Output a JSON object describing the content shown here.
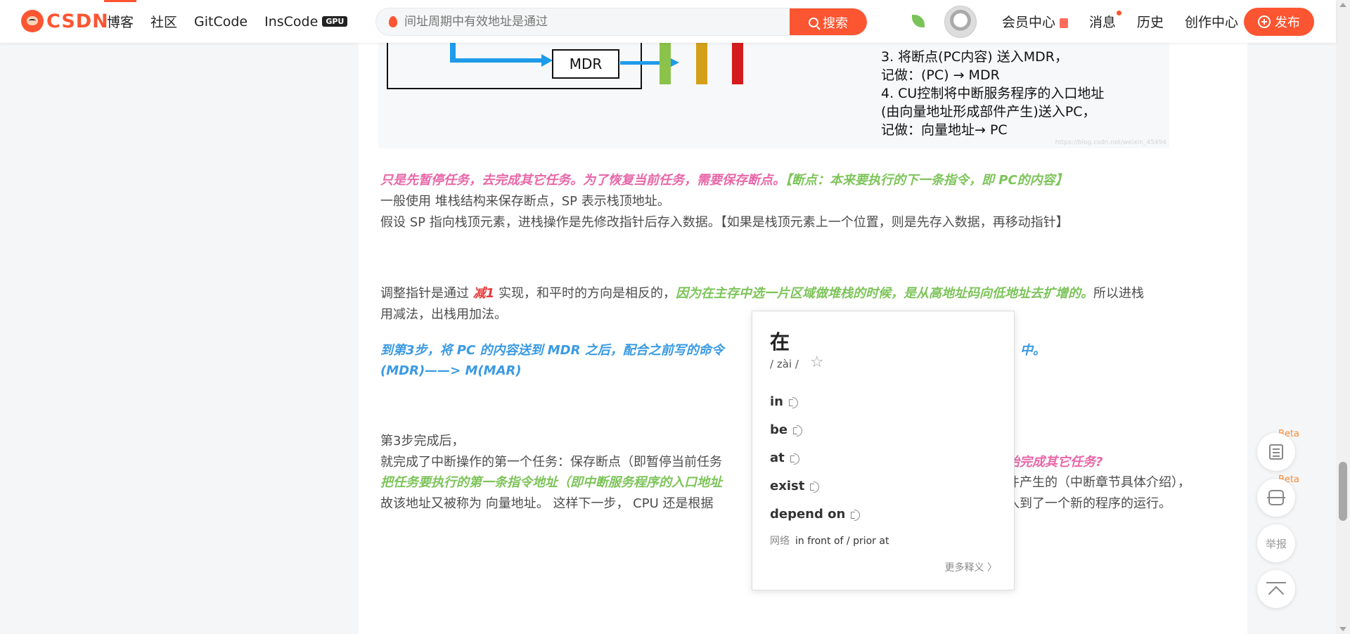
{
  "header": {
    "logo_text": "CSDN",
    "nav": [
      "博客",
      "社区",
      "GitCode",
      "InsCode"
    ],
    "gpu_badge": "GPU",
    "search_placeholder": "间址周期中有效地址是通过",
    "search_button": "搜索",
    "right_nav": {
      "member": "会员中心",
      "messages": "消息",
      "history": "历史",
      "create": "创作中心"
    },
    "publish": "发布",
    "accent_color": "#fc5531"
  },
  "figure": {
    "mdr_label": "MDR",
    "lines": [
      "3. 将断点(PC内容) 送入MDR，",
      "记做：(PC) → MDR",
      "4. CU控制将中断服务程序的入口地址",
      "(由向量地址形成部件产生)送入PC，",
      "记做：向量地址→ PC"
    ],
    "watermark": "https://blog.csdn.net/weixin_45494"
  },
  "article": {
    "p1_pink": "只是先暂停任务，去完成其它任务。为了恢复当前任务，需要保存断点。",
    "p1_green": "【断点：本来要执行的下一条指令，即 PC的内容】",
    "p2": "一般使用 堆栈结构来保存断点，SP 表示栈顶地址。",
    "p3": "假设 SP 指向栈顶元素，进栈操作是先修改指针后存入数据。【如果是栈顶元素上一个位置，则是先存入数据，再移动指针】",
    "p4_a": "调整指针是通过 ",
    "p4_red": "减1",
    "p4_b": " 实现，和平时的方向是相反的，",
    "p4_green": "因为在主存中选一片区域做堆栈的时候，是从高地址码向低地址去扩增的。",
    "p4_c": "所以进栈",
    "p5": "用减法，出栈用加法。",
    "p6_a": "到第3步，将 PC 的内容送到 MDR 之后，配合之前写的命令",
    "p6_b": "中。",
    "p7": "(MDR)——> M(MAR)",
    "p8": "第3步完成后，",
    "p9_a": "就完成了中断操作的第一个任务：保存断点（即暂停当前任务",
    "p9_pink": "始完成其它任务?",
    "p10_green": "把任务要执行的第一条指令地址（即中断服务程序的入口地址",
    "p10_b": "件产生的（中断章节具体介绍），",
    "p11_a": "故该地址又被称为 向量地址。 这样下一步， CPU 还是根据",
    "p11_b": "入到了一个新的程序的运行。"
  },
  "dictionary": {
    "word": "在",
    "pinyin": "/ zài /",
    "definitions": [
      "in",
      "be",
      "at",
      "exist",
      "depend on"
    ],
    "net_label": "网络",
    "net_value": "in front of / prior at",
    "more": "更多释义 〉"
  },
  "sidebar_tools": {
    "beta": "Beta",
    "report": "举报"
  }
}
